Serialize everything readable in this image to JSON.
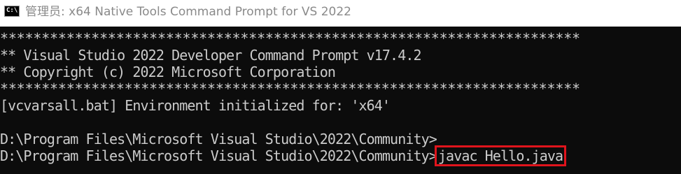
{
  "window": {
    "icon_label": "C:\\",
    "title": "管理员: x64 Native Tools Command Prompt for VS 2022"
  },
  "console": {
    "lines": [
      "**********************************************************************",
      "** Visual Studio 2022 Developer Command Prompt v17.4.2",
      "** Copyright (c) 2022 Microsoft Corporation",
      "**********************************************************************",
      "[vcvarsall.bat] Environment initialized for: 'x64'",
      "",
      "D:\\Program Files\\Microsoft Visual Studio\\2022\\Community>",
      "D:\\Program Files\\Microsoft Visual Studio\\2022\\Community>"
    ],
    "typed_command": "javac Hello.java"
  },
  "colors": {
    "console_background": "#0c0c0c",
    "console_text": "#cccccc",
    "highlight_box": "#e0141c",
    "title_text": "#8a8a8a"
  }
}
